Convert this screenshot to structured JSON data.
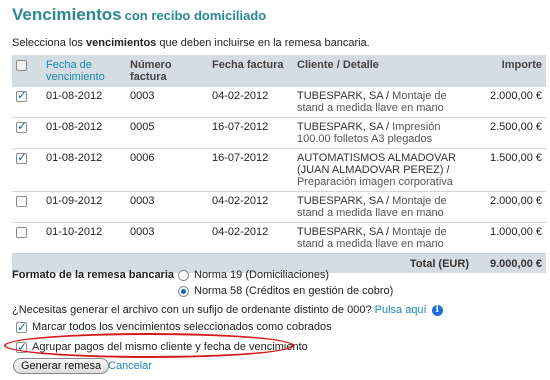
{
  "header": {
    "title": "Vencimientos",
    "subtitle": "con recibo domiciliado"
  },
  "intro": {
    "before": "Selecciona los ",
    "bold": "vencimientos",
    "after": " que deben incluirse en la remesa bancaria."
  },
  "table": {
    "columns": [
      "Fecha de vencimiento",
      "Número factura",
      "Fecha factura",
      "Cliente / Detalle",
      "Importe"
    ],
    "rows": [
      {
        "checked": true,
        "due_date": "01-08-2012",
        "invoice": "0003",
        "invoice_date": "04-02-2012",
        "client": "TUBESPARK, SA",
        "detail": "Montaje de stand a medida llave en mano",
        "amount": "2.000,00 €"
      },
      {
        "checked": true,
        "due_date": "01-08-2012",
        "invoice": "0005",
        "invoice_date": "16-07-2012",
        "client": "TUBESPARK, SA",
        "detail": "Impresión 100.00 folletos A3 plegados",
        "amount": "2.500,00 €"
      },
      {
        "checked": true,
        "due_date": "01-08-2012",
        "invoice": "0006",
        "invoice_date": "16-07-2012",
        "client": "AUTOMATISMOS ALMADOVAR (JUAN ALMADOVAR PEREZ)",
        "detail": "Preparación imagen corporativa",
        "amount": "1.500,00 €"
      },
      {
        "checked": false,
        "due_date": "01-09-2012",
        "invoice": "0003",
        "invoice_date": "04-02-2012",
        "client": "TUBESPARK, SA",
        "detail": "Montaje de stand a medida llave en mano",
        "amount": "2.000,00 €"
      },
      {
        "checked": false,
        "due_date": "01-10-2012",
        "invoice": "0003",
        "invoice_date": "04-02-2012",
        "client": "TUBESPARK, SA",
        "detail": "Montaje de stand a medida llave en mano",
        "amount": "1.000,00 €"
      }
    ],
    "total_label": "Total (EUR)",
    "total_value": "9.000,00 €"
  },
  "format": {
    "label": "Formato de la remesa bancaria",
    "options": [
      {
        "label": "Norma 19 (Domiciliaciones)",
        "selected": false
      },
      {
        "label": "Norma 58 (Créditos en gestión de cobro)",
        "selected": true
      }
    ]
  },
  "suffix": {
    "question": "¿Necesitas generar el archivo con un sufijo de ordenante distinto de 000?",
    "link": "Pulsa aquí"
  },
  "options": {
    "mark_paid": "Marcar todos los vencimientos seleccionados como cobrados",
    "group_payments": "Agrupar pagos del mismo cliente y fecha de vencimiento"
  },
  "actions": {
    "generate": "Generar remesa",
    "cancel": "Cancelar"
  },
  "colors": {
    "title": "#2a8a94",
    "link": "#1a8ab0",
    "header_bg": "#d5dde4",
    "highlight": "#d41a1a"
  }
}
